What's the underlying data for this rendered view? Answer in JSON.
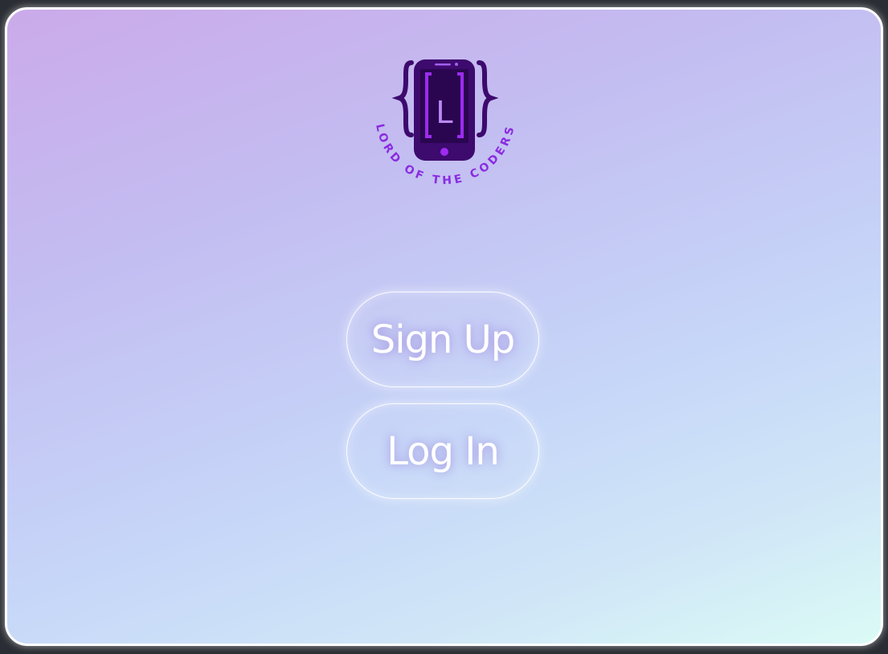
{
  "logo": {
    "letter": "L",
    "tagline": "LORD OF THE CODERS",
    "colors": {
      "phone": "#3d0a6e",
      "bracket": "#9d2bf0",
      "text": "#8a2be2"
    }
  },
  "buttons": {
    "signup_label": "Sign Up",
    "login_label": "Log In"
  },
  "colors": {
    "gradient_start": "#cbaaea",
    "gradient_end": "#dbfbf6",
    "border": "#ffffff",
    "outer_background": "#2a2d33"
  }
}
